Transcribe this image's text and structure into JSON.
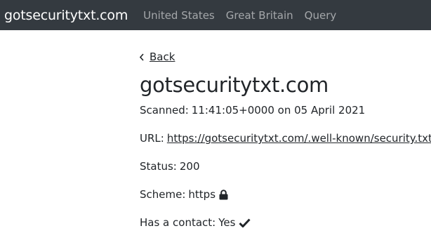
{
  "navbar": {
    "brand": "gotsecuritytxt.com",
    "links": [
      "United States",
      "Great Britain",
      "Query"
    ]
  },
  "back": {
    "icon": "chevron-left-icon",
    "label": "Back"
  },
  "site": {
    "title": "gotsecuritytxt.com",
    "scanned_label": "Scanned:",
    "scanned_value": "11:41:05+0000 on 05 April 2021",
    "url_label": "URL:",
    "url_value": "https://gotsecuritytxt.com/.well-known/security.txt",
    "status_label": "Status:",
    "status_value": "200",
    "scheme_label": "Scheme:",
    "scheme_value": "https",
    "scheme_icon": "lock-icon",
    "contact_label": "Has a contact:",
    "contact_value": "Yes",
    "contact_icon": "check-icon"
  },
  "colors": {
    "navbar_bg": "#343a40",
    "brand": "#ffffff",
    "nav_link": "#a6a9ac",
    "text": "#212529"
  }
}
